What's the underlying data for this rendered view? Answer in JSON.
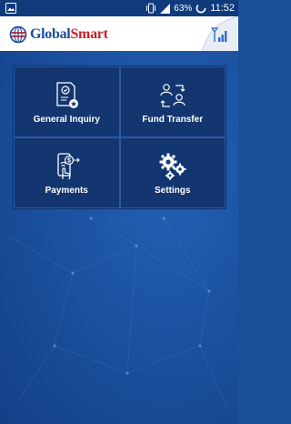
{
  "status_bar": {
    "battery": "63%",
    "time": "11:52"
  },
  "header": {
    "brand_part1": "Global",
    "brand_part2": "Smart"
  },
  "menu": [
    {
      "label": "General Inquiry",
      "icon": "document-badge-icon"
    },
    {
      "label": "Fund Transfer",
      "icon": "user-exchange-icon"
    },
    {
      "label": "Payments",
      "icon": "mobile-payment-icon"
    },
    {
      "label": "Settings",
      "icon": "gears-icon"
    }
  ],
  "colors": {
    "brand_blue": "#1a4a9a",
    "brand_red": "#c8202a",
    "background": "#1a4f9a"
  }
}
